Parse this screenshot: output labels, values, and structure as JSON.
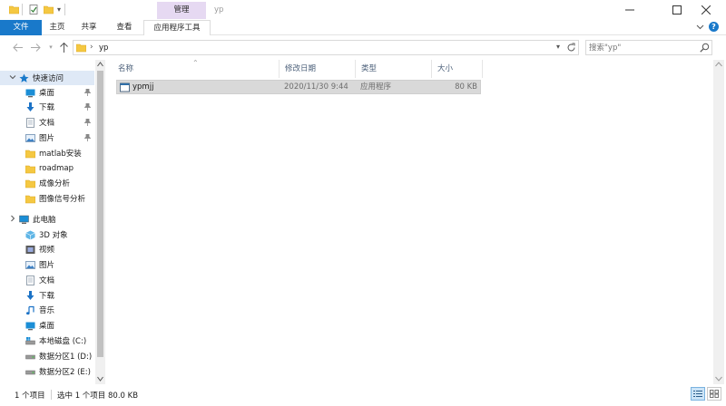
{
  "window": {
    "context_tab_header": "管理",
    "title": "yp"
  },
  "ribbon": {
    "tabs": [
      "文件",
      "主页",
      "共享",
      "查看",
      "应用程序工具"
    ]
  },
  "address": {
    "path_sep": "›",
    "path": "yp",
    "search_placeholder": "搜索\"yp\""
  },
  "navpane": {
    "quick_access": {
      "label": "快速访问",
      "items": [
        {
          "label": "桌面",
          "icon": "desktop-icon",
          "pinned": true
        },
        {
          "label": "下载",
          "icon": "download-icon",
          "pinned": true
        },
        {
          "label": "文档",
          "icon": "document-icon",
          "pinned": true
        },
        {
          "label": "图片",
          "icon": "picture-icon",
          "pinned": true
        },
        {
          "label": "matlab安装",
          "icon": "folder-icon",
          "pinned": false
        },
        {
          "label": "roadmap",
          "icon": "folder-icon",
          "pinned": false
        },
        {
          "label": "成像分析",
          "icon": "folder-icon",
          "pinned": false
        },
        {
          "label": "图像信号分析",
          "icon": "folder-icon",
          "pinned": false
        }
      ]
    },
    "this_pc": {
      "label": "此电脑",
      "items": [
        {
          "label": "3D 对象",
          "icon": "3d-objects-icon"
        },
        {
          "label": "视频",
          "icon": "video-icon"
        },
        {
          "label": "图片",
          "icon": "picture-icon"
        },
        {
          "label": "文档",
          "icon": "document-icon"
        },
        {
          "label": "下载",
          "icon": "download-icon"
        },
        {
          "label": "音乐",
          "icon": "music-icon"
        },
        {
          "label": "桌面",
          "icon": "desktop-icon"
        },
        {
          "label": "本地磁盘 (C:)",
          "icon": "drive-icon"
        },
        {
          "label": "数据分区1 (D:)",
          "icon": "drive-icon"
        },
        {
          "label": "数据分区2 (E:)",
          "icon": "drive-icon"
        }
      ]
    }
  },
  "content": {
    "columns": [
      "名称",
      "修改日期",
      "类型",
      "大小"
    ],
    "files": [
      {
        "name": "ypmjj",
        "modified": "2020/11/30 9:44",
        "type": "应用程序",
        "size": "80 KB",
        "selected": true
      }
    ]
  },
  "status": {
    "item_count": "1 个项目",
    "selection": "选中 1 个项目  80.0 KB"
  },
  "colors": {
    "accent": "#1979ca",
    "context_tab": "#e6d9f2",
    "selection": "#d9d9d9",
    "folder": "#f5c842"
  }
}
